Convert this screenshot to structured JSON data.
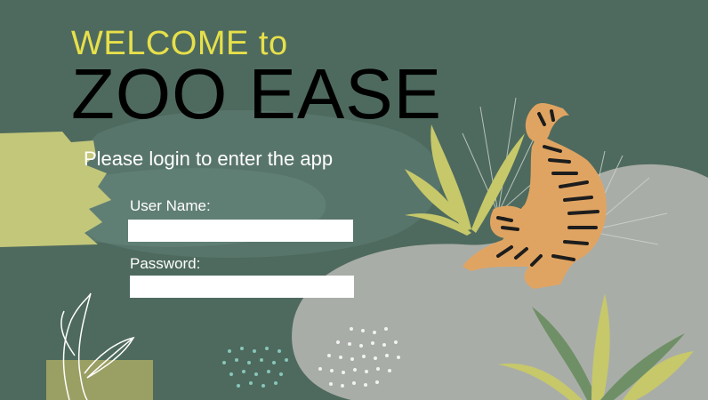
{
  "header": {
    "welcome": "WELCOME to",
    "app_name": "ZOO EASE",
    "subtitle": "Please login to enter the app"
  },
  "form": {
    "username_label": "User Name:",
    "username_value": "",
    "password_label": "Password:",
    "password_value": ""
  },
  "colors": {
    "background": "#4e6a5e",
    "welcome_text": "#e7e04a",
    "title_text": "#000000"
  },
  "decorations": [
    "tiger-illustration",
    "tropical-plant-leaves",
    "brush-stroke-texture"
  ]
}
